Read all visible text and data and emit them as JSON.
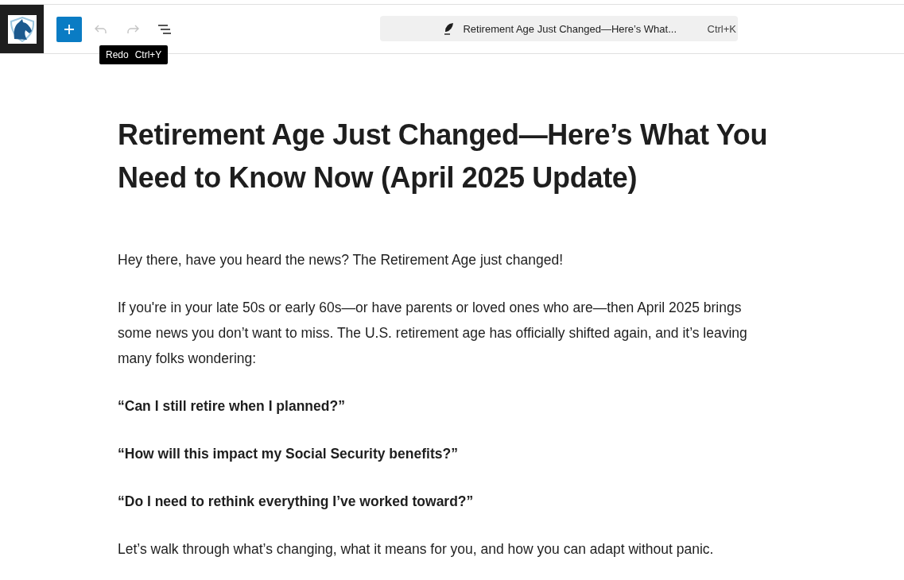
{
  "toolbar": {
    "undo": {
      "disabled": true
    },
    "redo": {
      "disabled": true
    },
    "tooltip": {
      "label": "Redo",
      "shortcut": "Ctrl+Y"
    }
  },
  "command_bar": {
    "title": "Retirement Age Just Changed—Here’s What...",
    "shortcut": "Ctrl+K"
  },
  "post": {
    "title": "Retirement Age Just Changed—Here’s What You Need to Know Now (April 2025 Update)",
    "paragraphs": [
      {
        "kind": "plain",
        "text": "Hey there, have you heard the news? The Retirement Age just changed!"
      },
      {
        "kind": "plain",
        "text": "If you're in your late 50s or early 60s—or have parents or loved ones who are—then April 2025 brings some news you don’t want to miss. The U.S. retirement age has officially shifted again, and it’s leaving many folks wondering:"
      },
      {
        "kind": "bold",
        "text": "“Can I still retire when I planned?”"
      },
      {
        "kind": "bold",
        "text": "“How will this impact my Social Security benefits?”"
      },
      {
        "kind": "bold",
        "text": "“Do I need to rethink everything I’ve worked toward?”"
      },
      {
        "kind": "plain",
        "text": "Let’s walk through what’s changing, what it means for you, and how you can adapt without panic."
      }
    ]
  }
}
